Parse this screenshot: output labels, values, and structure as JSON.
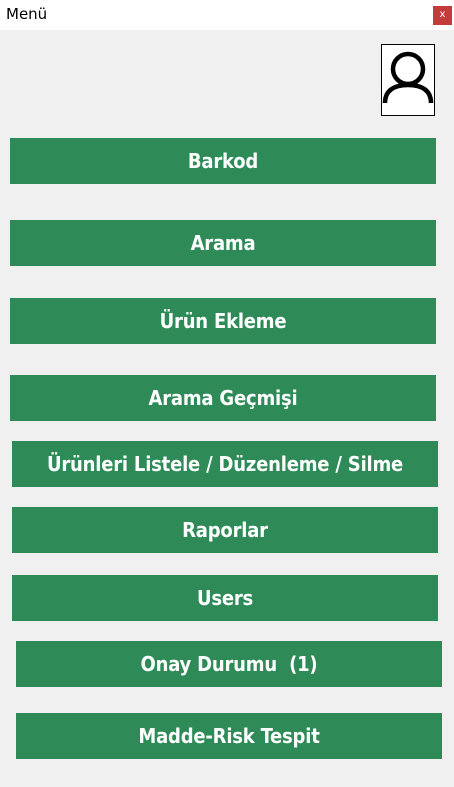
{
  "window": {
    "title": "Menü",
    "close_label": "x"
  },
  "avatar": {
    "icon": "user-icon"
  },
  "menu": {
    "items": [
      {
        "label": "Barkod"
      },
      {
        "label": "Arama"
      },
      {
        "label": "Ürün Ekleme"
      },
      {
        "label": "Arama Geçmişi"
      },
      {
        "label": "Ürünleri Listele / Düzenleme / Silme"
      },
      {
        "label": "Raporlar"
      },
      {
        "label": "Users"
      },
      {
        "label": "Onay Durumu  (1)"
      },
      {
        "label": "Madde-Risk Tespit"
      }
    ]
  },
  "colors": {
    "button_bg": "#2e8b57",
    "button_text": "#ffffff",
    "background": "#f0f0f0",
    "close_bg": "#c43b3b"
  }
}
